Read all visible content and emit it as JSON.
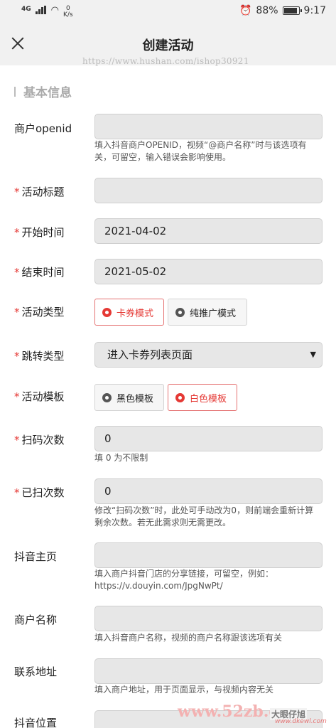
{
  "status_bar": {
    "signal": "4G",
    "speed_value": "0",
    "speed_unit": "K/s",
    "battery": "88%",
    "time": "9:17"
  },
  "header": {
    "title": "创建活动",
    "watermark": "https://www.hushan.com/ishop30921"
  },
  "section": {
    "title": "基本信息"
  },
  "form": {
    "merchant_openid": {
      "label": "商户openid",
      "value": "",
      "hint": "填入抖音商户OPENID，视频“@商户名称”时与该选项有关，可留空，输入错误会影响使用。"
    },
    "activity_title": {
      "label": "活动标题",
      "required": true,
      "value": ""
    },
    "start_time": {
      "label": "开始时间",
      "required": true,
      "value": "2021-04-02"
    },
    "end_time": {
      "label": "结束时间",
      "required": true,
      "value": "2021-05-02"
    },
    "activity_type": {
      "label": "活动类型",
      "required": true,
      "options": [
        "卡券模式",
        "纯推广模式"
      ],
      "selected": "卡券模式"
    },
    "jump_type": {
      "label": "跳转类型",
      "required": true,
      "value": "进入卡券列表页面"
    },
    "activity_template": {
      "label": "活动模板",
      "required": true,
      "options": [
        "黑色模板",
        "白色模板"
      ],
      "selected": "白色模板"
    },
    "scan_count": {
      "label": "扫码次数",
      "required": true,
      "value": "0",
      "hint": "填 0 为不限制"
    },
    "scanned_count": {
      "label": "已扫次数",
      "required": true,
      "value": "0",
      "hint": "修改“扫码次数”时，此处可手动改为0，则前端会重新计算剩余次数。若无此需求则无需更改。"
    },
    "douyin_homepage": {
      "label": "抖音主页",
      "value": "",
      "hint": "填入商户抖音门店的分享链接，可留空，例如：https://v.douyin.com/JpgNwPt/"
    },
    "merchant_name": {
      "label": "商户名称",
      "value": "",
      "hint": "填入抖音商户名称，视频的商户名称跟该选项有关"
    },
    "contact_address": {
      "label": "联系地址",
      "value": "",
      "hint": "填入商户地址，用于页面显示，与视频内容无关"
    },
    "douyin_location": {
      "label": "抖音位置"
    }
  },
  "watermark_bottom": {
    "site": "www.52zb.co",
    "logo": "大眼仔旭",
    "sub": "www.dkewl.com"
  },
  "colors": {
    "required": "#e53935",
    "active_border": "#e57373",
    "field_bg": "#e7e7e7",
    "header_bg": "#f1f1f1"
  }
}
